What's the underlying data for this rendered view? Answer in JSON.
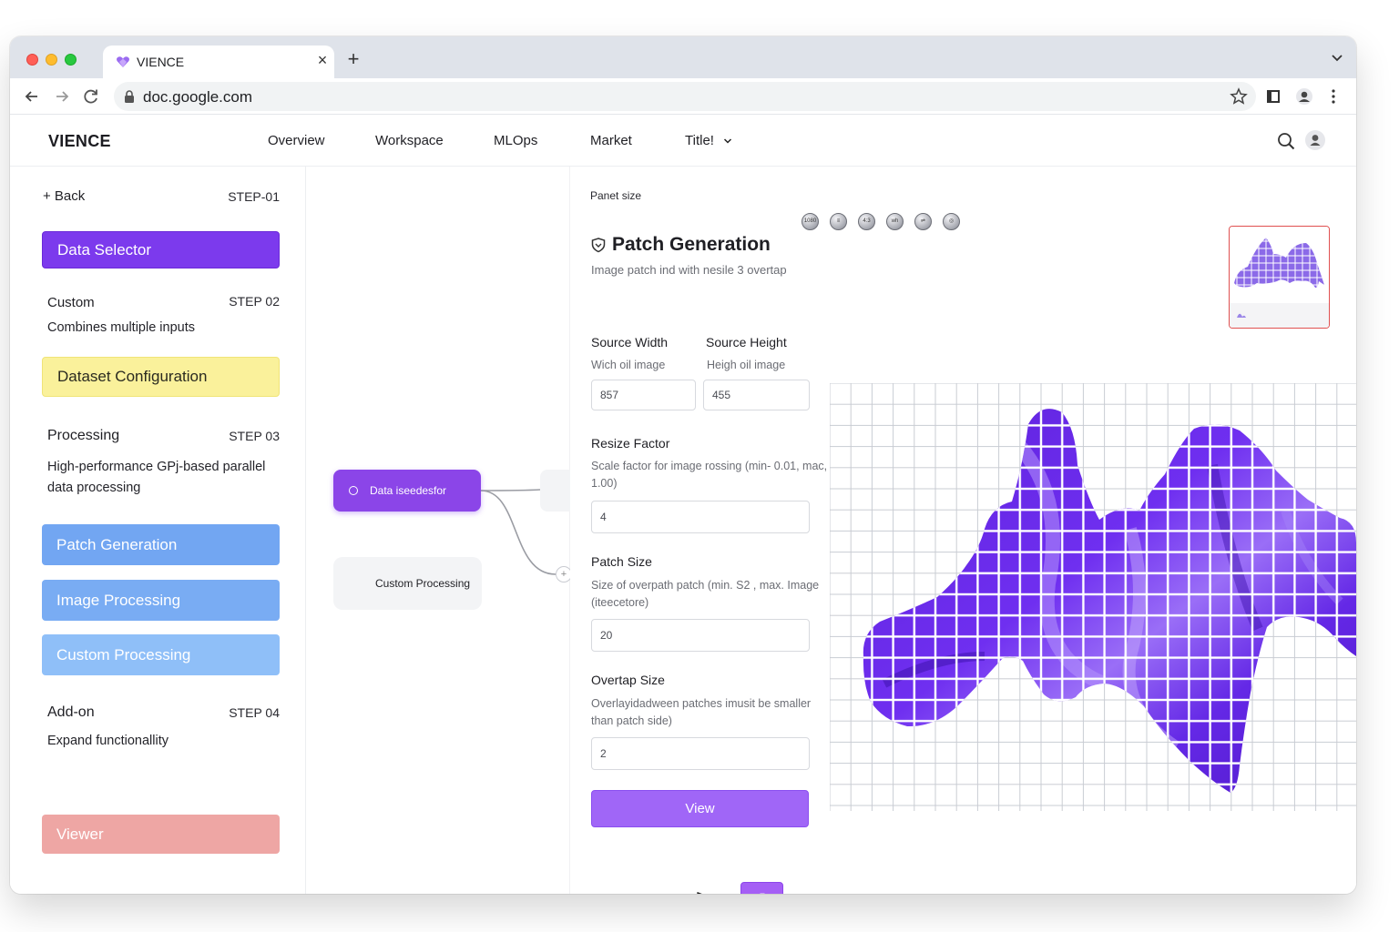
{
  "browser": {
    "tab_title": "VIENCE",
    "new_tab_symbol": "+",
    "close_symbol": "×",
    "url": "doc.google.com"
  },
  "header": {
    "brand": "VIENCE",
    "nav": [
      "Overview",
      "Workspace",
      "MLOps",
      "Market",
      "Title!"
    ]
  },
  "sidebar": {
    "back_label": "+ Back",
    "step1": "STEP-01",
    "data_selector": "Data Selector",
    "custom_title": "Custom",
    "step2": "STEP 02",
    "custom_desc": "Combines multiple inputs",
    "dataset_config": "Dataset Configuration",
    "processing_title": "Processing",
    "step3": "STEP 03",
    "processing_desc_1": "High-performance GPj-based parallel",
    "processing_desc_2": "data processing",
    "patch_generation": "Patch Generation",
    "image_processing": "Image Processing",
    "custom_processing": "Custom Processing",
    "addon_title": "Add-on",
    "step4": "STEP 04",
    "addon_desc": "Expand functionallity",
    "viewer": "Viewer"
  },
  "canvas": {
    "node_active": "Data iseedesfor",
    "node_custom": "Custom Processing",
    "port_symbol": "+"
  },
  "panel": {
    "panel_size_label": "Panet size",
    "tool_icons": [
      "1080",
      "≡",
      "4:3",
      "wh",
      "⇌",
      "◎"
    ],
    "title": "Patch Generation",
    "subtitle": "Image patch ind with nesile 3 overtap",
    "source_width": {
      "label": "Source Width",
      "help": "Wich oil image",
      "value": "857"
    },
    "source_height": {
      "label": "Source Height",
      "help": "Heigh oil image",
      "value": "455"
    },
    "resize_factor": {
      "label": "Resize Factor",
      "help_1": "Scale factor for image rossing (min- 0.01, mac,",
      "help_2": "1.00)",
      "value": "4"
    },
    "patch_size": {
      "label": "Patch Size",
      "help_1": "Size of overpath patch (min. S2 , max. Image",
      "help_2": "(iteecetore)",
      "value": "20"
    },
    "overtap_size": {
      "label": "Overtap Size",
      "help_1": "Overlayidadween patches imusit be smaller",
      "help_2": "than patch side)",
      "value": "2"
    },
    "view_button": "View"
  },
  "colors": {
    "accent_purple": "#7c3aed",
    "config_yellow": "#faf19b",
    "processing_blue": "#72a6f2",
    "viewer_pink": "#eea6a4"
  }
}
